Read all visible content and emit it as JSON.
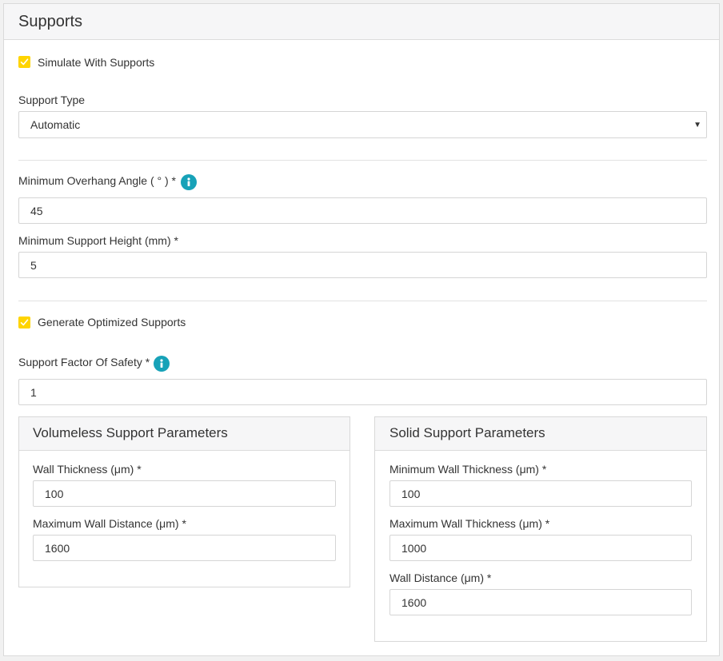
{
  "panel": {
    "title": "Supports"
  },
  "simulate_with_supports": {
    "label": "Simulate With Supports",
    "checked": true
  },
  "support_type": {
    "label": "Support Type",
    "value": "Automatic"
  },
  "min_overhang_angle": {
    "label": "Minimum Overhang Angle ( ° ) *",
    "value": "45"
  },
  "min_support_height": {
    "label": "Minimum Support Height (mm) *",
    "value": "5"
  },
  "generate_optimized_supports": {
    "label": "Generate Optimized Supports",
    "checked": true
  },
  "support_factor_of_safety": {
    "label": "Support Factor Of Safety *",
    "value": "1"
  },
  "volumeless": {
    "title": "Volumeless Support Parameters",
    "wall_thickness": {
      "label": "Wall Thickness (μm) *",
      "value": "100"
    },
    "max_wall_distance": {
      "label": "Maximum Wall Distance (μm) *",
      "value": "1600"
    }
  },
  "solid": {
    "title": "Solid Support Parameters",
    "min_wall_thickness": {
      "label": "Minimum Wall Thickness (μm) *",
      "value": "100"
    },
    "max_wall_thickness": {
      "label": "Maximum Wall Thickness (μm) *",
      "value": "1000"
    },
    "wall_distance": {
      "label": "Wall Distance (μm) *",
      "value": "1600"
    }
  },
  "colors": {
    "checkbox": "#ffd400",
    "info": "#17a2b8"
  },
  "icons": {
    "checkbox": "check-icon",
    "info": "info-icon",
    "select": "caret-down-icon"
  }
}
